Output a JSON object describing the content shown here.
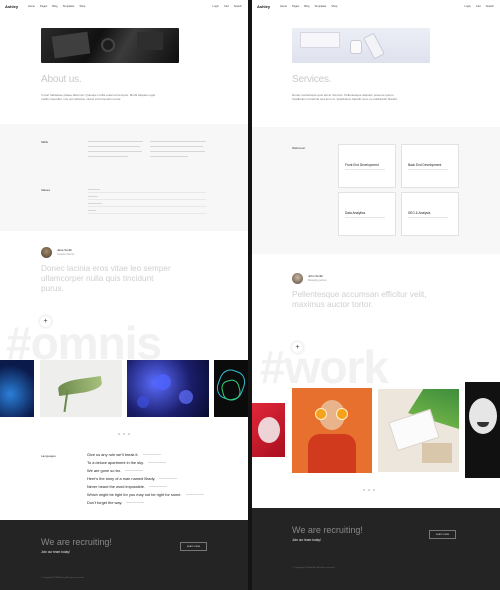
{
  "left": {
    "nav": {
      "logo": "Ashley",
      "menu": [
        "Home",
        "Pages",
        "Blog",
        "Templates",
        "Shop"
      ],
      "right": [
        "Login",
        "Cart",
        "Search"
      ]
    },
    "about_title": "About us.",
    "about_text": "In hac habitasse platea dictumst. Quisque mollis euismod tempus. Morbi aliquam eget mollis imperdiet, nisi vel vehicula, varius at fermentum tortor.",
    "skills_label": "Skills",
    "values_label": "Values",
    "author": {
      "name": "Jane Smith",
      "role": "Creative director"
    },
    "quote": "Donec lacinia eros vitae leo semper ullamcorper nulla quis tincidunt purus.",
    "bigword": "#omnis",
    "languages_label": "Languages",
    "phrases": [
      "Give us any rule we'll break it.",
      "To a deluxe apartment in the sky.",
      "We are gone so far.",
      "Here's the story of a man named Brady.",
      "Never heard the word impossible.",
      "Which might be tight for you may not be right for some.",
      "Don't forget the way."
    ],
    "footer": {
      "heading": "We are recruiting!",
      "sub": "Join our team today!",
      "button": "Learn more",
      "copy": "© Copyright 2018 Ashley. All rights reserved."
    }
  },
  "right": {
    "nav": {
      "logo": "Ashley",
      "menu": [
        "Home",
        "Pages",
        "Blog",
        "Templates",
        "Shop"
      ],
      "right": [
        "Login",
        "Cart",
        "Search"
      ]
    },
    "services_title": "Services.",
    "services_text": "Donec scelerisque quis elit at rhoncus. Pellentesque aliquam posuere ipsum. Vestibulum id lacinia sed arcu et. Vestibulum blandit nunc eu sollicitudin blandit.",
    "services_label": "Welcome!",
    "cards": [
      "Front End Development",
      "Back End Development",
      "Data Analytics",
      "SEO & Analysis"
    ],
    "author": {
      "name": "John Smith",
      "role": "Managing partner"
    },
    "quote": "Pellentesque accumsan efficitur velit, maximus auctor tortor.",
    "bigword": "#work",
    "footer": {
      "heading": "We are recruiting!",
      "sub": "Join our team today!",
      "button": "Learn more",
      "copy": "© Copyright 2018 Ashley. All rights reserved."
    }
  }
}
